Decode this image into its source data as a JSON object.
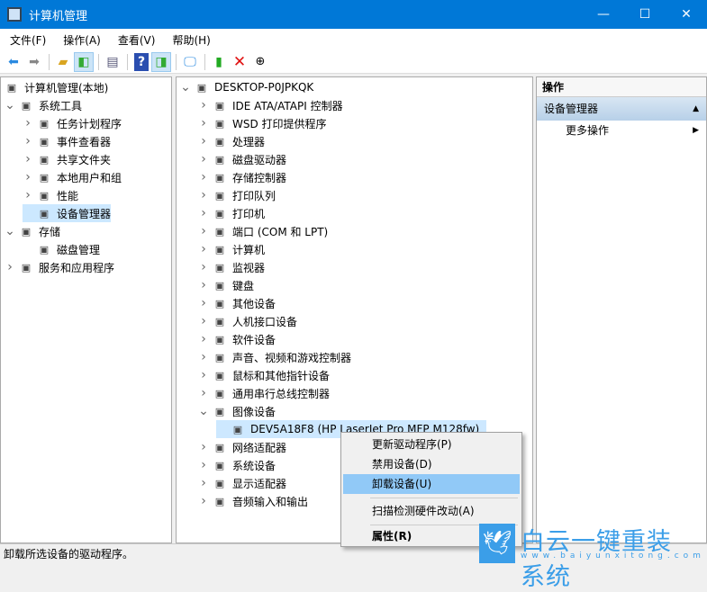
{
  "window": {
    "title": "计算机管理",
    "minimize": "—",
    "maximize": "☐",
    "close": "✕"
  },
  "menu": [
    "文件(F)",
    "操作(A)",
    "查看(V)",
    "帮助(H)"
  ],
  "toolbar": [
    "back-icon",
    "forward-icon",
    "up-folder-icon",
    "show-hide-tree-icon",
    "properties-icon",
    "help-icon",
    "show-action-pane-icon",
    "monitor-icon",
    "update-driver-icon",
    "uninstall-icon",
    "download-icon"
  ],
  "left_tree": [
    {
      "label": "计算机管理(本地)",
      "level": 0,
      "arrow": "",
      "icon": "computer-management-icon"
    },
    {
      "label": "系统工具",
      "level": 1,
      "arrow": "v",
      "icon": "tools-icon"
    },
    {
      "label": "任务计划程序",
      "level": 2,
      "arrow": ">",
      "icon": "clock-icon"
    },
    {
      "label": "事件查看器",
      "level": 2,
      "arrow": ">",
      "icon": "event-viewer-icon"
    },
    {
      "label": "共享文件夹",
      "level": 2,
      "arrow": ">",
      "icon": "shared-folder-icon"
    },
    {
      "label": "本地用户和组",
      "level": 2,
      "arrow": ">",
      "icon": "users-icon"
    },
    {
      "label": "性能",
      "level": 2,
      "arrow": ">",
      "icon": "performance-icon"
    },
    {
      "label": "设备管理器",
      "level": 2,
      "arrow": "",
      "icon": "device-manager-icon",
      "selected": true
    },
    {
      "label": "存储",
      "level": 1,
      "arrow": "v",
      "icon": "storage-icon"
    },
    {
      "label": "磁盘管理",
      "level": 2,
      "arrow": "",
      "icon": "disk-icon"
    },
    {
      "label": "服务和应用程序",
      "level": 1,
      "arrow": ">",
      "icon": "services-icon"
    }
  ],
  "device_tree": {
    "root": "DESKTOP-P0JPKQK",
    "items": [
      "IDE ATA/ATAPI 控制器",
      "WSD 打印提供程序",
      "处理器",
      "磁盘驱动器",
      "存储控制器",
      "打印队列",
      "打印机",
      "端口 (COM 和 LPT)",
      "计算机",
      "监视器",
      "键盘",
      "其他设备",
      "人机接口设备",
      "软件设备",
      "声音、视频和游戏控制器",
      "鼠标和其他指针设备",
      "通用串行总线控制器",
      "图像设备"
    ],
    "expanded_child": "DEV5A18F8 (HP LaserJet Pro MFP M128fw)",
    "after": [
      "网络适配器",
      "系统设备",
      "显示适配器",
      "音频输入和输出"
    ]
  },
  "actions": {
    "header": "操作",
    "section": "设备管理器",
    "more": "更多操作"
  },
  "context_menu": [
    "更新驱动程序(P)",
    "禁用设备(D)",
    "卸载设备(U)",
    "扫描检测硬件改动(A)",
    "属性(R)"
  ],
  "status": "卸载所选设备的驱动程序。",
  "watermark": {
    "name": "白云一键重装系统",
    "url": "www.baiyunxitong.com"
  },
  "colors": {
    "titlebar": "#0078d7",
    "selection": "#cce8ff",
    "menu_highlight": "#91c9f7"
  }
}
